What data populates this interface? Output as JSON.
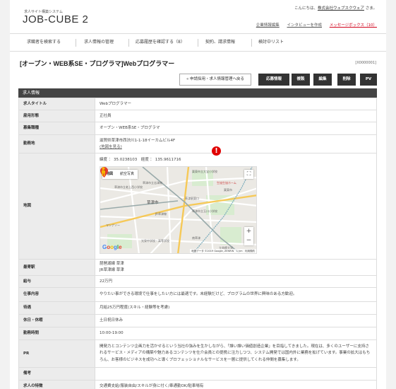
{
  "header": {
    "system_name": "求人サイト構築システム",
    "logo": "JOB-CUBE 2",
    "greeting_prefix": "こんにちは、",
    "company": "株式会社ウェブスクウェア",
    "greeting_suffix": " さま。",
    "links": {
      "company_info": "企業情報編集",
      "interview": "インタビューを作成",
      "messages": "メッセージボックス（10）"
    }
  },
  "nav": [
    "求職者を検索する",
    "求人情報の管理",
    "応募履歴を確認する（8）",
    "契約、請求情報",
    "検討中リスト"
  ],
  "job": {
    "title": "[オープン・WEB系SE・プログラマ]Webプログラマー",
    "id": "[X0000001]"
  },
  "actions": {
    "to_list": "« 申請採用・求人情報管理へ戻る",
    "apply_info": "応募情報",
    "copy": "複製",
    "edit": "編集",
    "delete": "削除",
    "pv": "PV"
  },
  "section_title": "求人情報",
  "rows": [
    {
      "label": "求人タイトル",
      "value": "Webプログラマー"
    },
    {
      "label": "雇用形態",
      "value": "正社員"
    },
    {
      "label": "募集職種",
      "value": "オープン・WEB系SE・プログラマ"
    },
    {
      "label": "勤務地",
      "value": "滋賀県草津市西渋川1-1-18イーカムビル4F",
      "link": "(地図を見る)"
    },
    {
      "label": "地図"
    },
    {
      "label": "最寄駅",
      "value": "琵琶湖線 草津",
      "value2": "JR草津線 草津"
    },
    {
      "label": "給与",
      "value": "22万円"
    },
    {
      "label": "仕事内容",
      "value": "やりたい事ができる環境で仕事をしたい方には最適です。未経験だけど、プログラムの世界に興味のある方歓迎。"
    },
    {
      "label": "待遇",
      "value": "月給25万円程度(スキル・経験等を考慮)"
    },
    {
      "label": "休日・休暇",
      "value": "土日祝日休み"
    },
    {
      "label": "勤務時間",
      "value": "10:00-19:00"
    },
    {
      "label": "PR",
      "value": "開発力とコンテンツ企画力を活かせるという当社の強みを生かしながら、「誰い誰い価値創造企業」を目指してきました。現在は、多くのユーザーに支持されるサービス・メディアの構築や魅力あるコンテンツを仕介会員との提携に注力しつつ、システム開発では国内外に業務を拡げています。事業の拡大はもちろん、お客様のビジネスを成功へと導くプロフェッショナルなサービスを一層に提供してくれる仲間を募集します。"
    },
    {
      "label": "備考",
      "value": ""
    },
    {
      "label": "求人の特徴",
      "value": "交通費支給/服装自由/スキルが身に付く/車通勤OK/駐車場有"
    }
  ],
  "map": {
    "coords": "緯度 ： 35.0238103　経度 ： 135.9611716",
    "type_map": "地図",
    "type_satellite": "航空写真",
    "city": "草津市",
    "pois": [
      "栗東市立大宝小学校",
      "草津市立老上西小学校",
      "草津市立志津南",
      "草津市立玉川小学校",
      "マンナソー",
      "光泉中学校・高等学校",
      "南草津",
      "栗東市",
      "立命館大学",
      "生協生協ホーム",
      "草津駅東口",
      "JR草津線"
    ],
    "footer": "地図データ ©2019 Google, ZENRIN　1 km　利用規約",
    "google": "Google",
    "zoom_in": "+",
    "zoom_out": "−",
    "fullscreen": "⛶"
  },
  "colors": {
    "accent_red": "#d0021b",
    "section_bg": "#444444",
    "label_bg": "#ececec",
    "map_pin": "#e33b2e"
  }
}
